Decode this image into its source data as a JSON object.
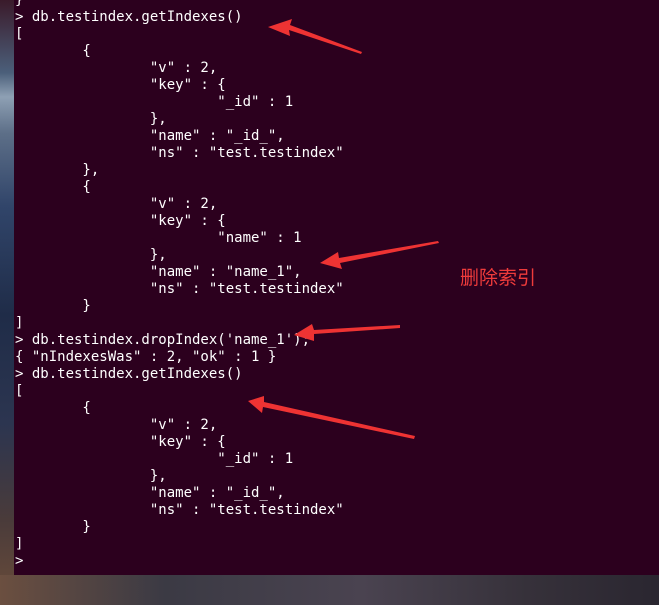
{
  "terminal": {
    "lines": [
      "}",
      "> db.testindex.getIndexes()",
      "[",
      "        {",
      "                \"v\" : 2,",
      "                \"key\" : {",
      "                        \"_id\" : 1",
      "                },",
      "                \"name\" : \"_id_\",",
      "                \"ns\" : \"test.testindex\"",
      "        },",
      "        {",
      "                \"v\" : 2,",
      "                \"key\" : {",
      "                        \"name\" : 1",
      "                },",
      "                \"name\" : \"name_1\",",
      "                \"ns\" : \"test.testindex\"",
      "        }",
      "]",
      "> db.testindex.dropIndex('name_1');",
      "{ \"nIndexesWas\" : 2, \"ok\" : 1 }",
      "> db.testindex.getIndexes()",
      "[",
      "        {",
      "                \"v\" : 2,",
      "                \"key\" : {",
      "                        \"_id\" : 1",
      "                },",
      "                \"name\" : \"_id_\",",
      "                \"ns\" : \"test.testindex\"",
      "        }",
      "]",
      "> "
    ]
  },
  "annotation": {
    "label": "删除索引",
    "color": "#ef3b3b"
  },
  "colors": {
    "terminal_bg": "#2c001e",
    "terminal_fg": "#ffffff"
  }
}
